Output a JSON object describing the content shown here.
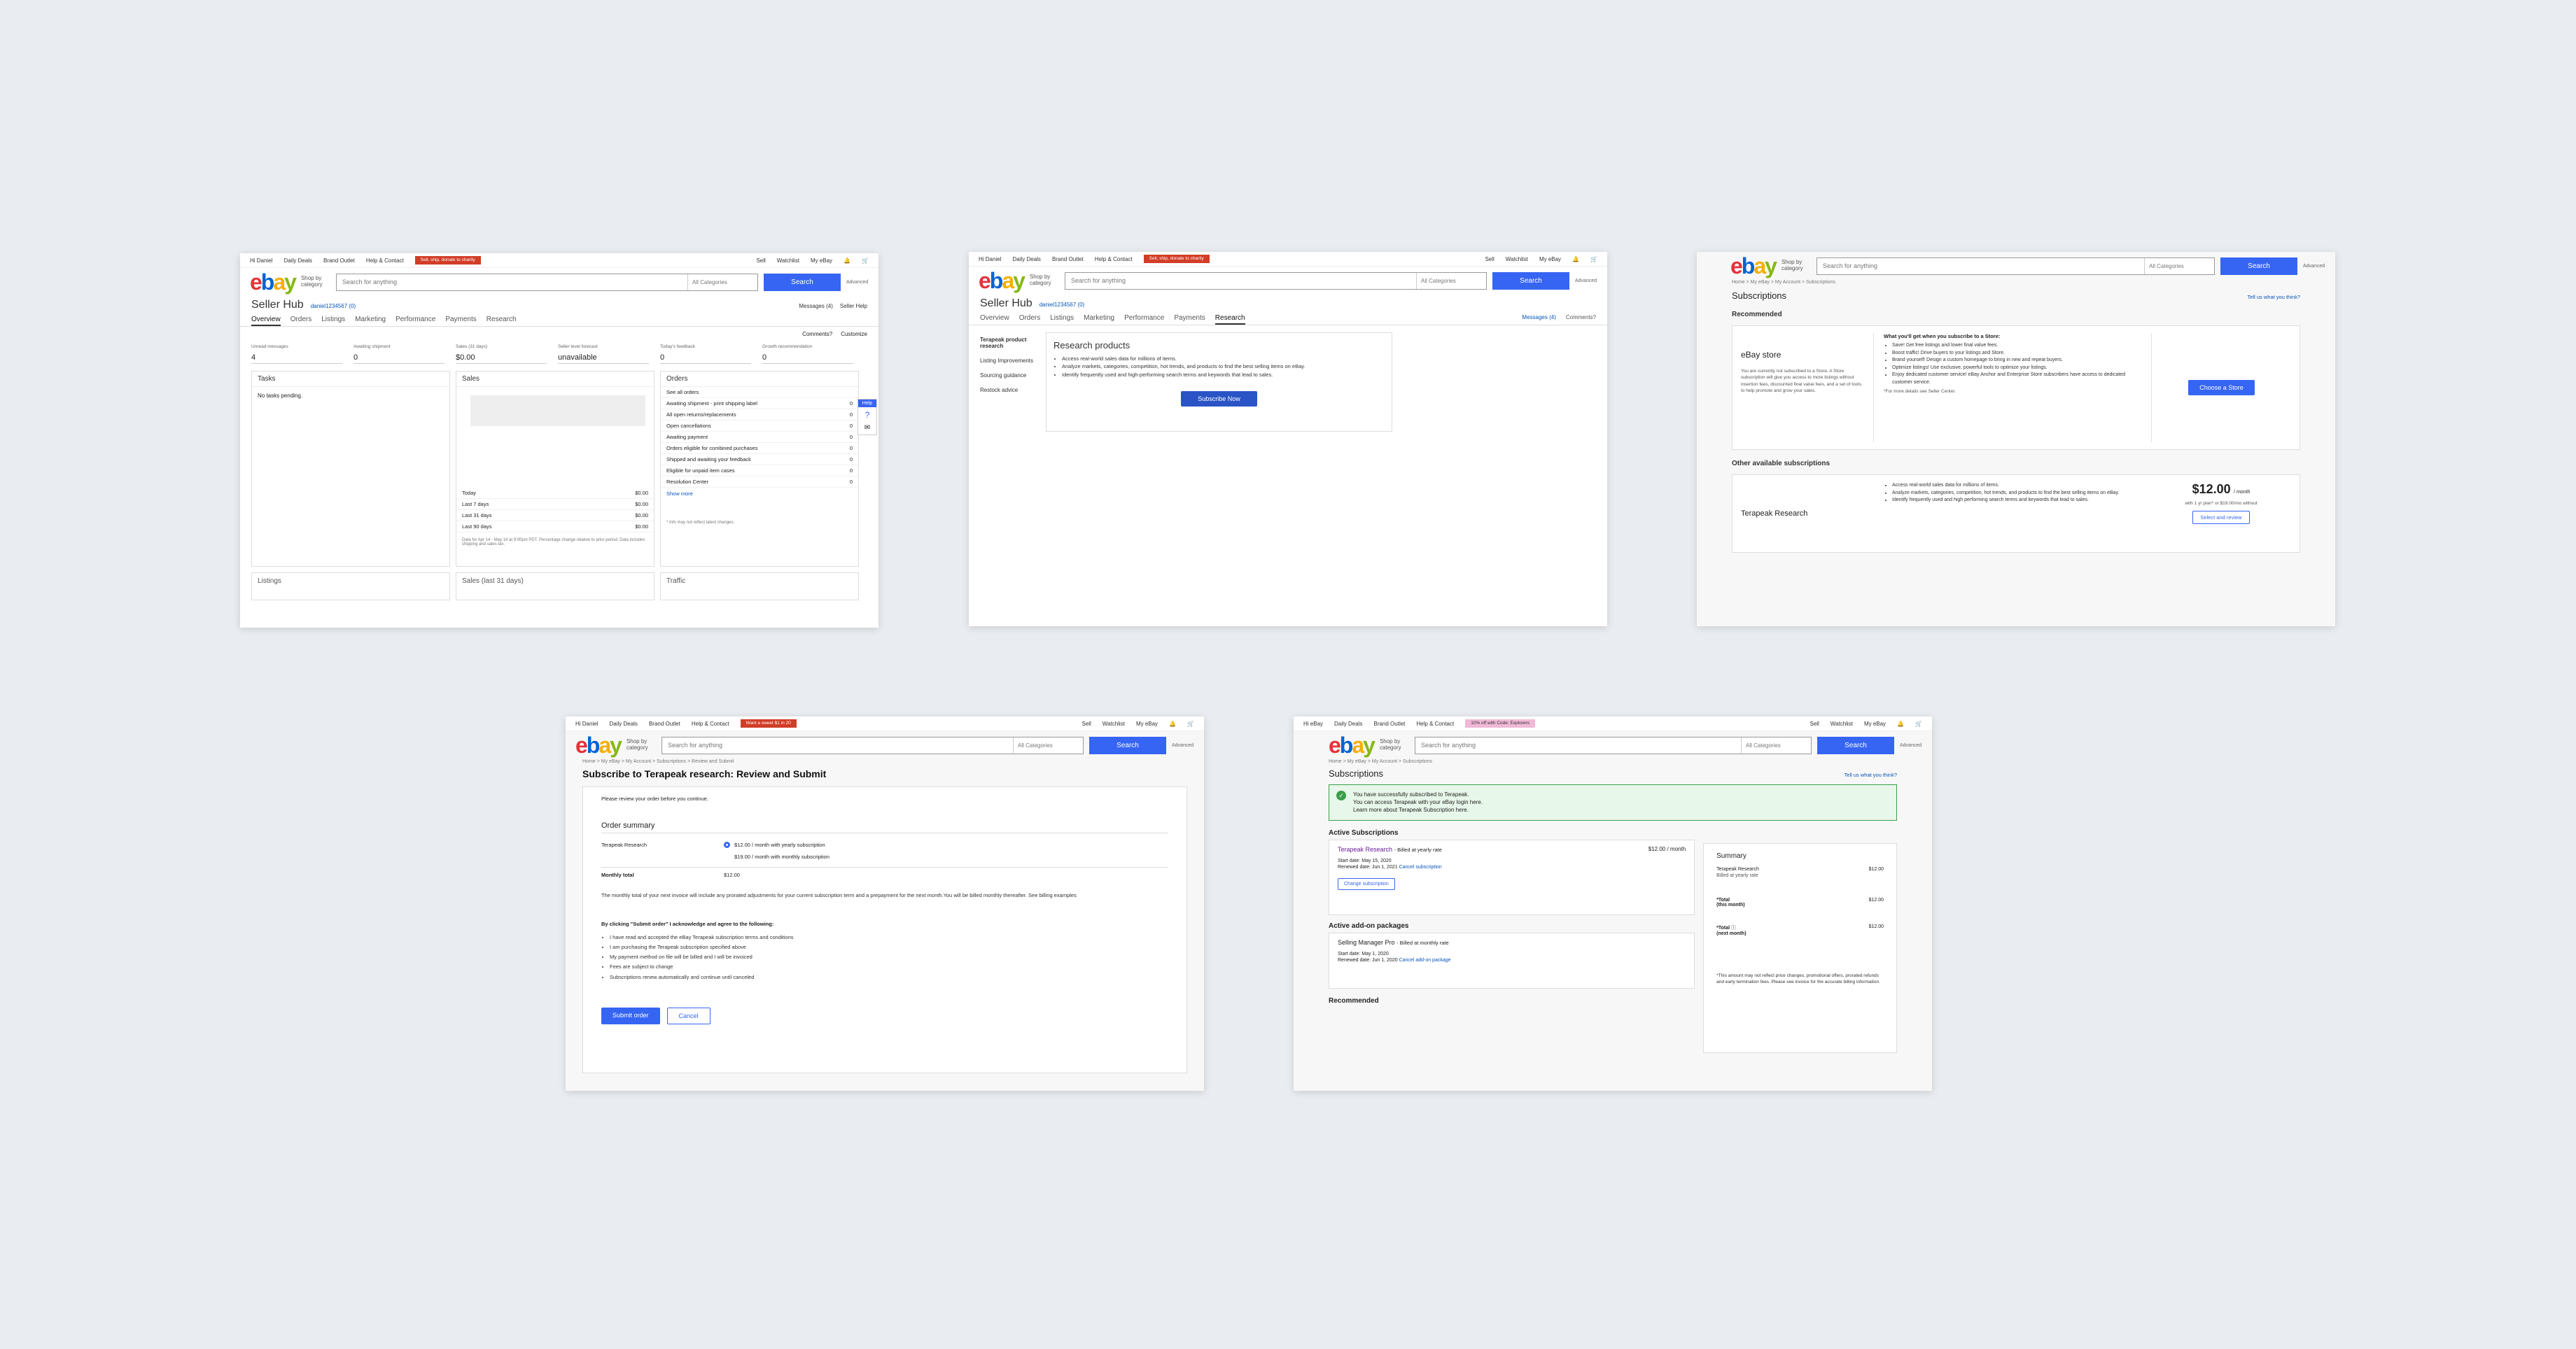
{
  "common": {
    "user": "Hi Daniel",
    "daily_deals": "Daily Deals",
    "brand_outlet": "Brand Outlet",
    "help_contact": "Help & Contact",
    "sell": "Sell",
    "watchlist": "Watchlist",
    "my_ebay": "My eBay",
    "search_placeholder": "Search for anything",
    "all_categories": "All Categories",
    "search_btn": "Search",
    "advanced": "Advanced",
    "shop_by": "Shop by category",
    "promo": "Sell, ship, donate to charity",
    "promo4": "Want a sweet $1 in 20"
  },
  "hub": {
    "title": "Seller Hub",
    "user_id": "daniel1234567 (0)",
    "messages": "Messages (4)",
    "seller_help": "Seller Help",
    "tabs": [
      "Overview",
      "Orders",
      "Listings",
      "Marketing",
      "Performance",
      "Payments",
      "Research"
    ],
    "comments": "Comments?",
    "customize": "Customize",
    "stats": [
      {
        "label": "Unread messages",
        "value": "4"
      },
      {
        "label": "Awaiting shipment",
        "value": "0"
      },
      {
        "label": "Sales (31 days)",
        "value": "$0.00"
      },
      {
        "label": "Seller level forecast",
        "value": "unavailable"
      },
      {
        "label": "Today's feedback",
        "value": "0"
      },
      {
        "label": "Growth recommendation",
        "value": "0"
      }
    ],
    "tasks_title": "Tasks",
    "tasks_empty": "No tasks pending.",
    "sales_title": "Sales",
    "sales_rows": [
      [
        "Today",
        "$0.00"
      ],
      [
        "Last 7 days",
        "$0.00"
      ],
      [
        "Last 31 days",
        "$0.00"
      ],
      [
        "Last 90 days",
        "$0.00"
      ]
    ],
    "sales_note": "Data for Apr 14 - May 14 at 9:00pm PDT. Percentage change relative to prior period. Data includes shipping and sales tax.",
    "orders_title": "Orders",
    "orders_rows": [
      [
        "See all orders",
        ""
      ],
      [
        "Awaiting shipment - print shipping label",
        "0"
      ],
      [
        "All open returns/replacements",
        "0"
      ],
      [
        "Open cancellations",
        "0"
      ],
      [
        "Awaiting payment",
        "0"
      ],
      [
        "Orders eligible for combined purchases",
        "0"
      ],
      [
        "Shipped and awaiting your feedback",
        "0"
      ],
      [
        "Eligible for unpaid item cases",
        "0"
      ],
      [
        "Resolution Center",
        "0"
      ]
    ],
    "show_more": "Show more",
    "orders_note": "* Info may not reflect latest changes.",
    "help": "Help",
    "bottom": [
      "Listings",
      "Sales (last 31 days)",
      "Traffic"
    ]
  },
  "research": {
    "side": [
      "Terapeak product research",
      "Listing Improvements",
      "Sourcing guidance",
      "Restock advice"
    ],
    "title": "Research products",
    "bullets": [
      "Access real-world sales data for millions of items.",
      "Analyze markets, categories, competition, hot trends, and products to find the best selling items on eBay.",
      "Identify frequently used and high-performing search terms and keywords that lead to sales."
    ],
    "subscribe": "Subscribe Now"
  },
  "subs": {
    "crumb": "Home > My eBay > My Account > Subscriptions",
    "title": "Subscriptions",
    "feedback": "Tell us what you think?",
    "recommended": "Recommended",
    "store_name": "eBay store",
    "store_desc": "You are currently not subscribed to a Store. A Store subscription will give you access to more listings without insertion fees, discounted final value fees, and a set of tools to help promote and grow your sales.",
    "store_head": "What you'll get when you subscribe to a Store:",
    "store_bullets": [
      "Save! Get free listings and lower final value fees.",
      "Boost traffic! Drive buyers to your listings and Store.",
      "Brand yourself! Design a custom homepage to bring in new and repeat buyers.",
      "Optimize listings! Use exclusive, powerful tools to optimize your listings.",
      "Enjoy dedicated customer service! eBay Anchor and Enterprise Store subscribers have access to dedicated customer service."
    ],
    "store_more": "*For more details see Seller Center.",
    "choose": "Choose a Store",
    "other": "Other available subscriptions",
    "tera_name": "Terapeak Research",
    "tera_bullets": [
      "Access real-world sales data for millions of items.",
      "Analyze markets, categories, competition, hot trends, and products to find the best selling items on eBay.",
      "Identify frequently used and high performing search terms and keywords that lead to sales."
    ],
    "price": "$12.00",
    "per": "/ month",
    "price_note": "with 1 yr plan* or $19.00/mo without",
    "select": "Select and review"
  },
  "review": {
    "crumb": "Home > My eBay > My Account > Subscriptions > Review and Submit",
    "title": "Subscribe to Terapeak research: Review and Submit",
    "intro": "Please review your order before you continue.",
    "summary": "Order summary",
    "item": "Terapeak Research",
    "opt1": "$12.00 / month with yearly subscription",
    "opt2": "$19.00 / month with monthly subscription",
    "monthly_total": "Monthly total",
    "total_val": "$12.00",
    "note": "The monthly total of your next invoice will include any prorated adjustments for your current subscription term and a prepayment for the next month.You will be billed monthly thereafter. See billing examples",
    "agree": "By clicking \"Submit order\" I acknowledge and agree to the following:",
    "agree_items": [
      "I have read and accepted the eBay Terapeak subscription terms and conditions",
      "I am purchasing the Terapeak subscription specified above",
      "My payment method on file will be billed and I will be invoiced",
      "Fees are subject to change",
      "Subscriptions renew automatically and continue until canceled"
    ],
    "submit": "Submit order",
    "cancel": "Cancel"
  },
  "done": {
    "user": "Hi eBay",
    "promo": "10% off with Code: Explorers",
    "crumb": "Home > My eBay > My Account > Subscriptions",
    "title": "Subscriptions",
    "feedback": "Tell us what you think?",
    "alert1": "You have successfully subscribed to Terapeak.",
    "alert2": "You can access Terapeak with your eBay login here.",
    "alert3": "Learn more about Terapeak Subscription here.",
    "active": "Active Subscriptions",
    "sub_name": "Terapeak Research",
    "sub_rate": "- Billed at yearly rate",
    "sub_price": "$12.00 / month",
    "start": "Start date: May 15, 2020",
    "renew": "Renewed date: Jun 1, 2021",
    "cancel_sub": "Cancel subscription",
    "change": "Change subscription",
    "addons": "Active add-on packages",
    "addon_name": "Selling Manager Pro",
    "addon_rate": "- Billed at monthly rate",
    "addon_start": "Start date: May 1, 2020",
    "addon_renew": "Renewed date: Jun 1, 2020",
    "cancel_addon": "Cancel add-on package",
    "recommended": "Recommended",
    "summary": "Summary",
    "sum_item": "Terapeak Research",
    "sum_item_val": "$12.00",
    "sum_rate": "Billed at yearly rate",
    "total1": "*Total",
    "total1_sub": "(this month)",
    "total1_val": "$12.00",
    "total2": "*Total",
    "total2_sub": "(next month)",
    "total2_val": "$12.00",
    "fine": "*This amount may not reflect price changes, promotional offers, prorated refunds and early termination fees. Please see invoice for the accurate billing information."
  }
}
